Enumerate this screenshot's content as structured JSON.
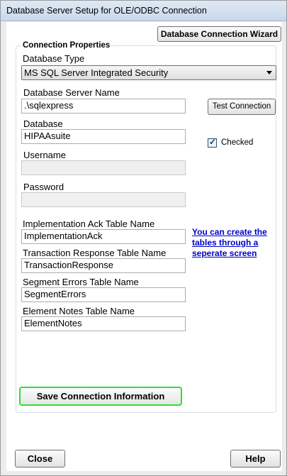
{
  "window": {
    "title": "Database Server Setup for OLE/ODBC Connection"
  },
  "toolbar": {
    "wizard_label": "Database Connection Wizard"
  },
  "connection": {
    "group_title": "Connection Properties",
    "database_type_label": "Database Type",
    "database_type_value": "MS SQL Server Integrated Security",
    "server_name_label": "Database Server Name",
    "server_name_value": ".\\sqlexpress",
    "test_connection_label": "Test Connection",
    "database_label": "Database",
    "database_value": "HIPAAsuite",
    "checked_label": "Checked",
    "username_label": "Username",
    "username_value": "",
    "password_label": "Password",
    "password_value": ""
  },
  "tables": {
    "impl_ack_label": "Implementation Ack Table Name",
    "impl_ack_value": "ImplementationAck",
    "txn_response_label": "Transaction Response Table Name",
    "txn_response_value": "TransactionResponse",
    "segment_errors_label": "Segment Errors Table Name",
    "segment_errors_value": "SegmentErrors",
    "element_notes_label": "Element Notes Table Name",
    "element_notes_value": "ElementNotes",
    "create_tables_link": "You can create the tables through a seperate screen"
  },
  "actions": {
    "save_label": "Save Connection Information",
    "close_label": "Close",
    "help_label": "Help"
  },
  "colors": {
    "save_highlight": "#33dd33",
    "link": "#0000cc"
  }
}
